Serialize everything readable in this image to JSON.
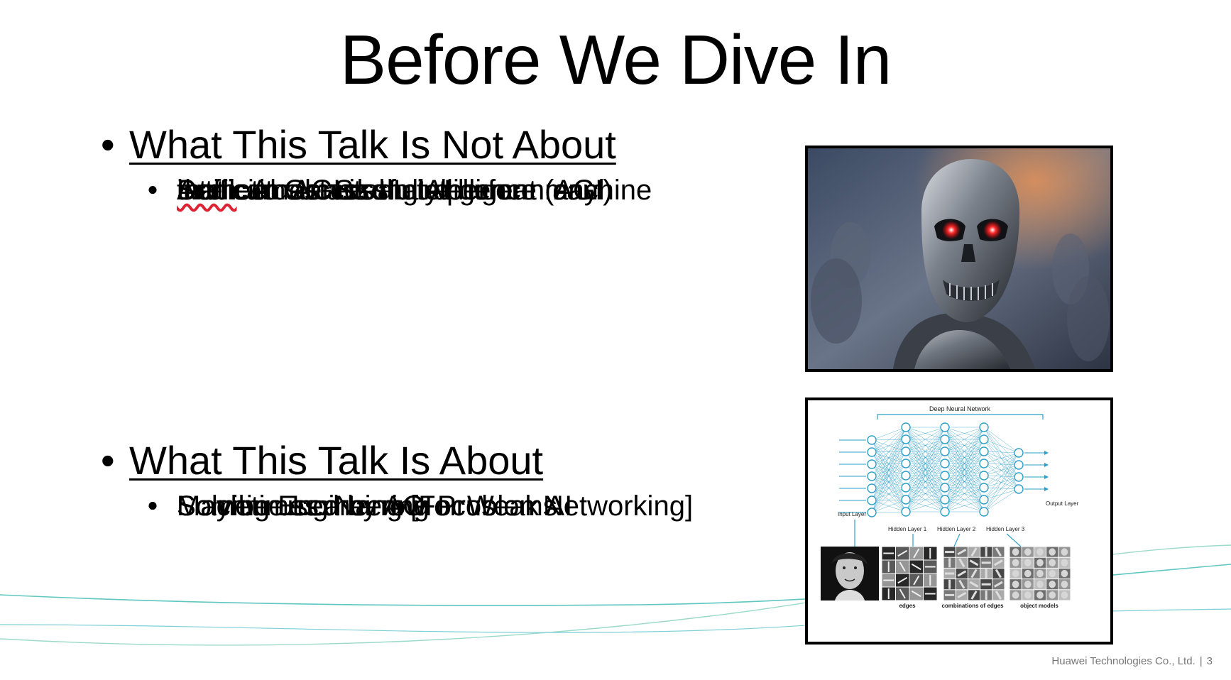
{
  "slide": {
    "title": "Before We Dive In",
    "sections": [
      {
        "heading": "What This Talk Is Not About",
        "items": [
          {
            "text": "Artificial General Intelligence (AGI)"
          },
          {
            "term": "Defn",
            "text": ": An AGI is an intelligent machine"
          },
          {
            "text": "that can successfully perform any",
            "continuation": true
          },
          {
            "text": "intellectual task that a human can",
            "continuation": true
          },
          {
            "text": "Sometimes: Strong AI"
          }
        ]
      },
      {
        "heading": "What This Talk Is About",
        "items": [
          {
            "text": "Machine Learning [Focus on Networking]"
          },
          {
            "text": "Solving Engineering Problems"
          },
          {
            "text": "May be used by AGI"
          },
          {
            "text": "Sometimes: Narrow or Weak AI"
          }
        ]
      }
    ],
    "images": [
      {
        "name": "terminator-robot-photo",
        "alt": "robot skull photo"
      },
      {
        "name": "deep-neural-network-diagram"
      }
    ],
    "diagram": {
      "title": "Deep Neural Network",
      "input_label": "Input Layer",
      "output_label": "Output Layer",
      "hidden_labels": [
        "Hidden Layer 1",
        "Hidden Layer 2",
        "Hidden Layer 3"
      ],
      "feature_labels": [
        "edges",
        "combinations of edges",
        "object models"
      ],
      "color": "#2e9fc7"
    },
    "footer": {
      "company": "Huawei Technologies Co., Ltd.",
      "page": "3"
    },
    "colors": {
      "wave": "#5fc6c0",
      "text": "#000000",
      "spellcheck": "#dd2233"
    }
  }
}
